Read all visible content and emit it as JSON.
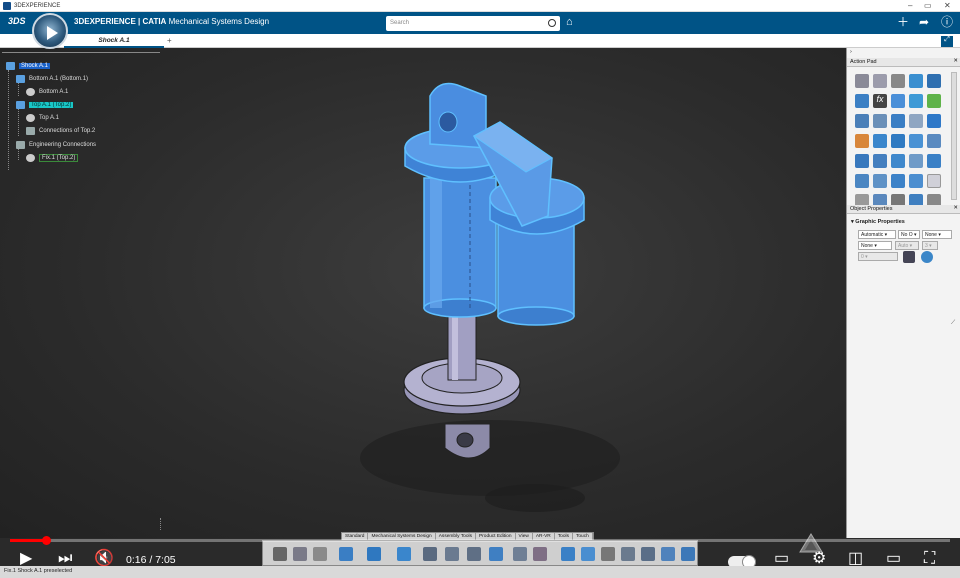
{
  "window": {
    "title": "3DEXPERIENCE"
  },
  "header": {
    "brand_bold": "3DEXPERIENCE",
    "brand_sep": " | ",
    "brand_app": "CATIA",
    "brand_role": "Mechanical Systems Design",
    "search_placeholder": "Search"
  },
  "tabs": [
    {
      "label": "Shock A.1"
    }
  ],
  "tree": {
    "nodes": [
      {
        "label": "Shock A.1",
        "style": "selected"
      },
      {
        "label": "Bottom A.1 (Bottom.1)"
      },
      {
        "label": "Bottom A.1"
      },
      {
        "label": "Top A.1 (Top.2)",
        "style": "preselected"
      },
      {
        "label": "Top A.1"
      },
      {
        "label": "Connections of Top.2"
      },
      {
        "label": "Engineering Connections"
      },
      {
        "label": "Fix.1 (Top.2)",
        "style": "framed"
      }
    ]
  },
  "action_pad": {
    "title": "Action Pad"
  },
  "object_properties": {
    "title": "Object Properties",
    "section": "Graphic Properties",
    "row1": [
      "Automatic",
      "No O",
      "None"
    ],
    "row2": [
      "None",
      "Auto",
      "3"
    ],
    "row3": [
      "0"
    ]
  },
  "command_tabs": [
    "Standard",
    "Mechanical Systems Design",
    "Assembly Tools",
    "Product Edition",
    "View",
    "AR-VR",
    "Tools",
    "Touch"
  ],
  "status_bar": {
    "text": "Fix.1 Shock A.1 preselected"
  },
  "player": {
    "time": "0:16 / 7:05",
    "progress": 0.038
  },
  "colors": {
    "header_bg": "#005386",
    "selection": "#1b62c9",
    "preselection": "#19c6c6",
    "part_highlight": "#4aa3ff",
    "progress": "#ff0000"
  }
}
